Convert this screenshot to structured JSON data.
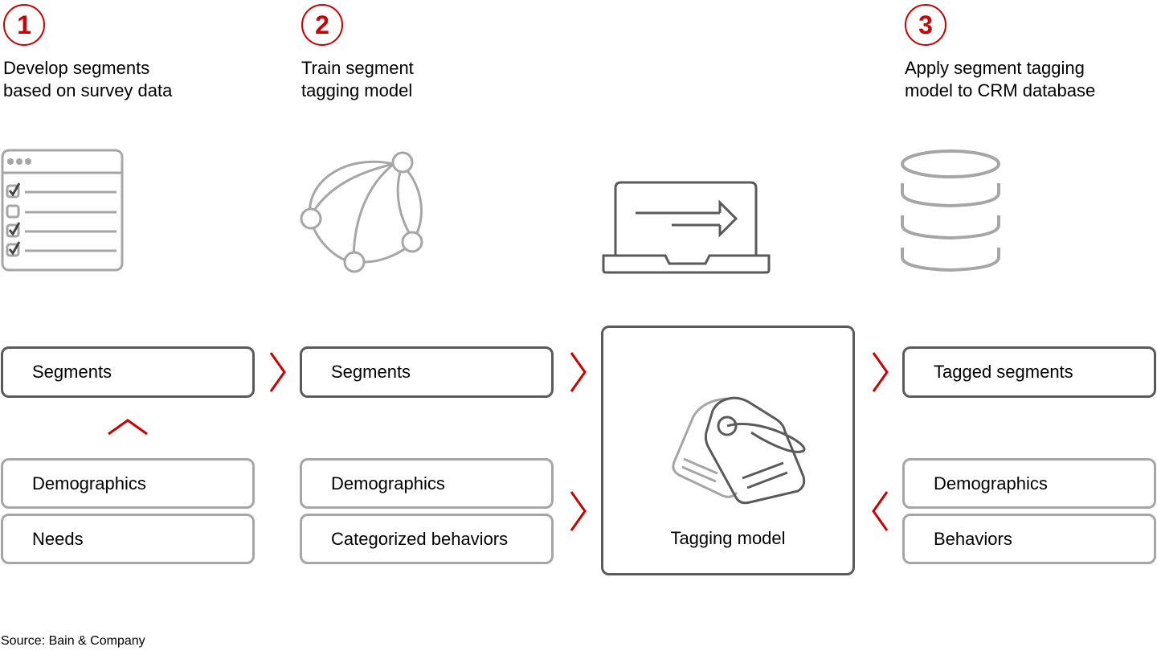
{
  "colors": {
    "accent": "#cc0000",
    "dark_stroke": "#5a5a5a",
    "light_stroke": "#a6a6a6"
  },
  "steps": [
    {
      "number": "1",
      "title": "Develop segments\nbased on survey data",
      "icon": "survey-checklist-icon"
    },
    {
      "number": "2",
      "title": "Train segment\ntagging model",
      "icon": "network-sphere-icon"
    },
    {
      "number": "3",
      "title": "Apply segment tagging\nmodel to CRM database",
      "icon": "database-icon"
    }
  ],
  "center": {
    "icon": "laptop-arrow-icon",
    "model_icon": "tags-icon",
    "label": "Tagging model"
  },
  "column1": {
    "output": "Segments",
    "inputs": [
      "Demographics",
      "Needs"
    ],
    "arrow": "up-chevron"
  },
  "column2": {
    "output": "Segments",
    "inputs": [
      "Demographics",
      "Categorized behaviors"
    ]
  },
  "column3": {
    "output": "Tagged segments",
    "inputs": [
      "Demographics",
      "Behaviors"
    ]
  },
  "source": "Source: Bain & Company"
}
